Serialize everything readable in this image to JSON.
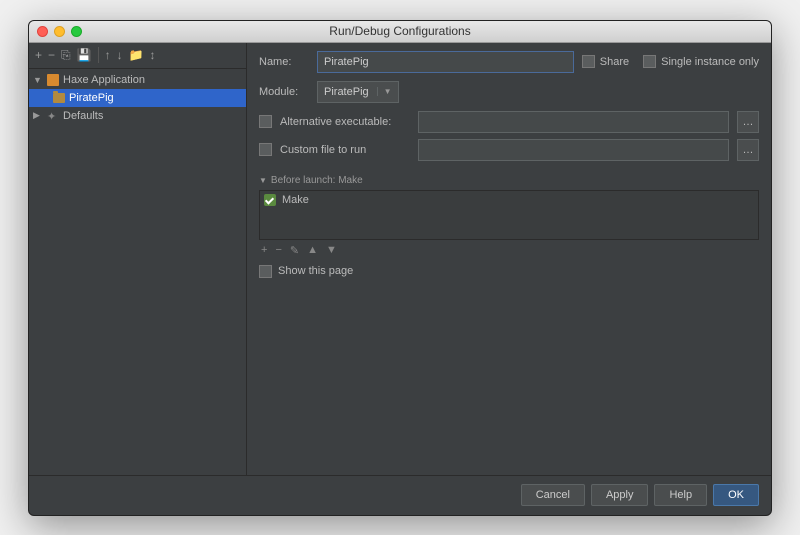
{
  "window": {
    "title": "Run/Debug Configurations"
  },
  "tree": {
    "root": {
      "label": "Haxe Application"
    },
    "config": {
      "label": "PiratePig"
    },
    "defaults": {
      "label": "Defaults"
    }
  },
  "form": {
    "name_label": "Name:",
    "name_value": "PiratePig",
    "share_label": "Share",
    "single_label": "Single instance only",
    "module_label": "Module:",
    "module_value": "PiratePig",
    "alt_exec_label": "Alternative executable:",
    "custom_file_label": "Custom file to run",
    "before_launch_label": "Before launch: Make",
    "make_label": "Make",
    "show_page_label": "Show this page"
  },
  "buttons": {
    "cancel": "Cancel",
    "apply": "Apply",
    "help": "Help",
    "ok": "OK"
  }
}
